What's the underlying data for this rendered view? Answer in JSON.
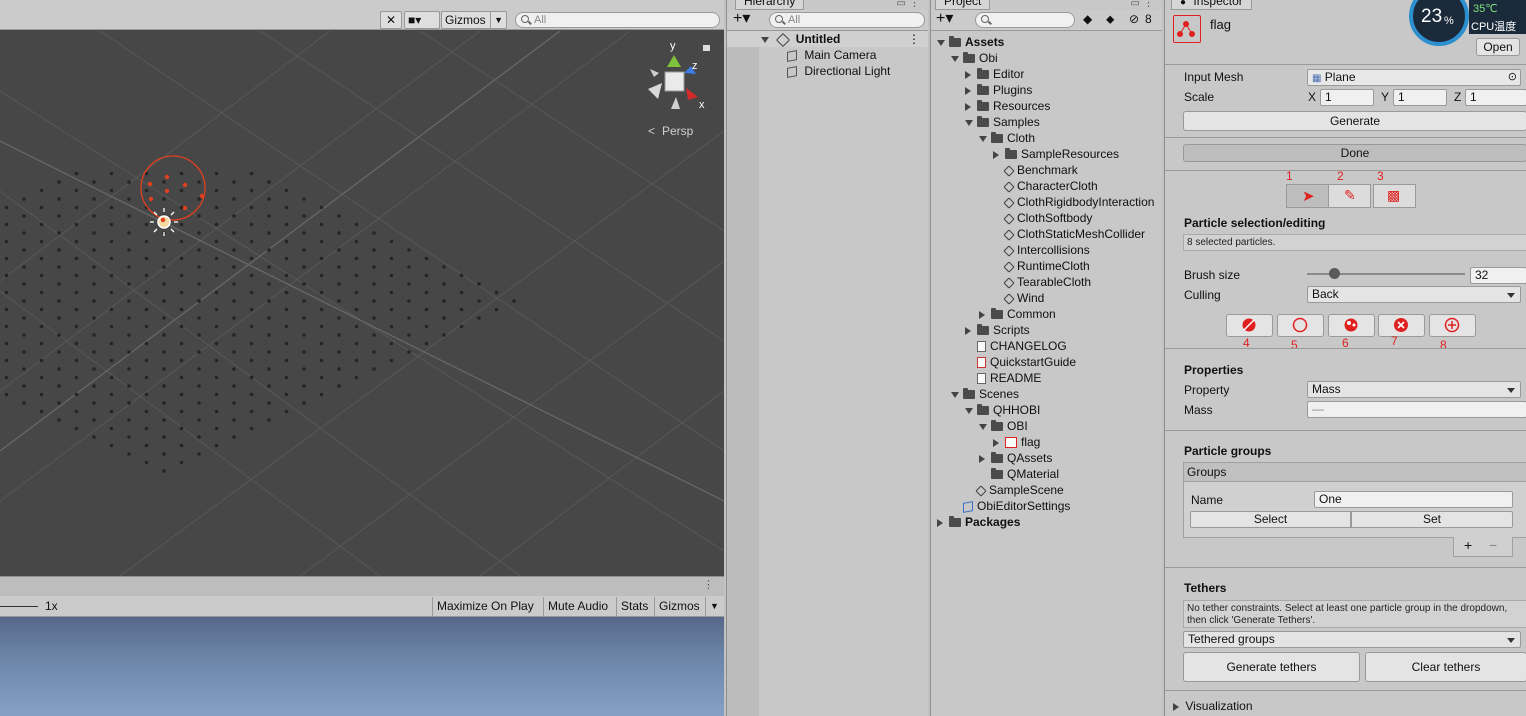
{
  "scene": {
    "toolbar": {
      "gizmos_label": "Gizmos",
      "search_placeholder": "All"
    },
    "persp_label": "Persp",
    "axis_labels": {
      "x": "x",
      "y": "y",
      "z": "z"
    }
  },
  "game": {
    "scale_label": "1x",
    "maximize_label": "Maximize On Play",
    "mute_label": "Mute Audio",
    "stats_label": "Stats",
    "gizmos_label": "Gizmos"
  },
  "hierarchy": {
    "tab_label": "Hierarchy",
    "search_placeholder": "All",
    "scene_name": "Untitled",
    "items": [
      "Main Camera",
      "Directional Light"
    ]
  },
  "project": {
    "tab_label": "Project",
    "hidden_count": "8",
    "tree": [
      {
        "label": "Assets",
        "depth": 0,
        "type": "folder",
        "open": true,
        "bold": true
      },
      {
        "label": "Obi",
        "depth": 1,
        "type": "folder",
        "open": true
      },
      {
        "label": "Editor",
        "depth": 2,
        "type": "folder",
        "open": false
      },
      {
        "label": "Plugins",
        "depth": 2,
        "type": "folder",
        "open": false
      },
      {
        "label": "Resources",
        "depth": 2,
        "type": "folder",
        "open": false
      },
      {
        "label": "Samples",
        "depth": 2,
        "type": "folder",
        "open": true
      },
      {
        "label": "Cloth",
        "depth": 3,
        "type": "folder",
        "open": true
      },
      {
        "label": "SampleResources",
        "depth": 4,
        "type": "folder",
        "open": false
      },
      {
        "label": "Benchmark",
        "depth": 4,
        "type": "scene"
      },
      {
        "label": "CharacterCloth",
        "depth": 4,
        "type": "scene"
      },
      {
        "label": "ClothRigidbodyInteraction",
        "depth": 4,
        "type": "scene"
      },
      {
        "label": "ClothSoftbody",
        "depth": 4,
        "type": "scene"
      },
      {
        "label": "ClothStaticMeshCollider",
        "depth": 4,
        "type": "scene"
      },
      {
        "label": "Intercollisions",
        "depth": 4,
        "type": "scene"
      },
      {
        "label": "RuntimeCloth",
        "depth": 4,
        "type": "scene"
      },
      {
        "label": "TearableCloth",
        "depth": 4,
        "type": "scene"
      },
      {
        "label": "Wind",
        "depth": 4,
        "type": "scene"
      },
      {
        "label": "Common",
        "depth": 3,
        "type": "folder",
        "open": false
      },
      {
        "label": "Scripts",
        "depth": 2,
        "type": "folder",
        "open": false
      },
      {
        "label": "CHANGELOG",
        "depth": 2,
        "type": "doc"
      },
      {
        "label": "QuickstartGuide",
        "depth": 2,
        "type": "pdf"
      },
      {
        "label": "README",
        "depth": 2,
        "type": "doc"
      },
      {
        "label": "Scenes",
        "depth": 1,
        "type": "folder",
        "open": true
      },
      {
        "label": "QHHOBI",
        "depth": 2,
        "type": "folder",
        "open": true
      },
      {
        "label": "OBI",
        "depth": 3,
        "type": "folder",
        "open": true
      },
      {
        "label": "flag",
        "depth": 4,
        "type": "blueprint",
        "collapsed": true
      },
      {
        "label": "QAssets",
        "depth": 3,
        "type": "folder",
        "open": false
      },
      {
        "label": "QMaterial",
        "depth": 3,
        "type": "folder",
        "leaf": true
      },
      {
        "label": "SampleScene",
        "depth": 2,
        "type": "scene"
      },
      {
        "label": "ObiEditorSettings",
        "depth": 1,
        "type": "settings"
      },
      {
        "label": "Packages",
        "depth": 0,
        "type": "folder",
        "open": false,
        "bold": true
      }
    ]
  },
  "inspector": {
    "tab_label": "Inspector",
    "object_name": "flag",
    "open_label": "Open",
    "cpu": {
      "percent": "23",
      "percent_unit": "%",
      "temp": "35℃",
      "label": "CPU温度"
    },
    "input_mesh_label": "Input Mesh",
    "input_mesh_value": "Plane",
    "scale_label": "Scale",
    "scale": {
      "x_label": "X",
      "x": "1",
      "y_label": "Y",
      "y": "1",
      "z_label": "Z",
      "z": "1"
    },
    "generate_label": "Generate",
    "done_label": "Done",
    "tool_numbers": [
      "1",
      "2",
      "3"
    ],
    "selection_title": "Particle selection/editing",
    "selected_info": "8 selected particles.",
    "brush_label": "Brush size",
    "brush_value": "32",
    "brush_fraction": 0.17,
    "culling_label": "Culling",
    "culling_value": "Back",
    "action_numbers": [
      "4",
      "5",
      "6",
      "7",
      "8"
    ],
    "properties_title": "Properties",
    "property_label": "Property",
    "property_value": "Mass",
    "mass_label": "Mass",
    "mass_value": "—",
    "groups_section_title": "Particle groups",
    "groups_header": "Groups",
    "group_name_label": "Name",
    "group_name_value": "One",
    "select_label": "Select",
    "set_label": "Set",
    "add_label": "+",
    "remove_label": "−",
    "tethers_title": "Tethers",
    "tethers_info": "No tether constraints. Select at least one particle group in the dropdown, then click 'Generate Tethers'.",
    "tethered_groups_label": "Tethered groups",
    "generate_tethers_label": "Generate tethers",
    "clear_tethers_label": "Clear tethers",
    "visualization_label": "Visualization"
  },
  "colors": {
    "accent_red": "#e0201f",
    "scene_bg": "#474747",
    "panel_bg": "#c8c8c8"
  }
}
